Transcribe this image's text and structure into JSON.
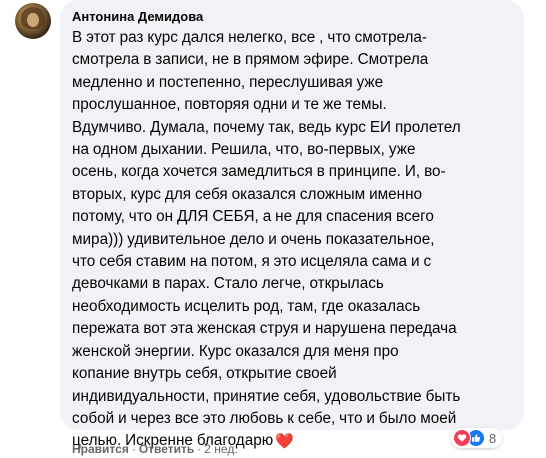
{
  "comment": {
    "author": "Антонина Демидова",
    "text_lines": [
      "В этот раз курс дался нелегко, все , что смотрела-",
      "смотрела в записи, не в прямом эфире. Смотрела",
      "медленно и постепенно, переслушивая уже",
      "прослушанное, повторяя одни и те же темы.",
      "Вдумчиво. Думала, почему так, ведь курс ЕИ пролетел",
      "на одном дыхании. Решила, что, во-первых, уже",
      "осень, когда хочется замедлиться в принципе. И, во-",
      "вторых, курс для себя оказался сложным именно",
      "потому, что он ДЛЯ СЕБЯ, а не для спасения всего",
      "мира))) удивительное дело и очень показательное,",
      "что себя ставим на потом, я это исцеляла сама и с",
      "девочками в парах. Стало легче, открылась",
      "необходимость исцелить род, там, где оказалась",
      "пережата вот эта женская струя и нарушена передача",
      "женской энергии. Курс оказался для меня про",
      "копание внутрь себя, открытие своей",
      "индивидуальности, принятие себя, удовольствие быть",
      "собой и через все это любовь к себе, что и было моей",
      "целью. Искренне благодарю"
    ],
    "heart_emoji": "❤️"
  },
  "actions": {
    "like": "Нравится",
    "separator": "·",
    "reply": "Ответить",
    "time": "2 нед."
  },
  "reactions": {
    "icons": [
      "love-icon",
      "like-icon"
    ],
    "count": "8",
    "colors": {
      "love": "#f33e58",
      "like": "#1877f2"
    }
  },
  "colors": {
    "bubble": "#f0f2f5",
    "text": "#050505",
    "secondary": "#65676b"
  }
}
